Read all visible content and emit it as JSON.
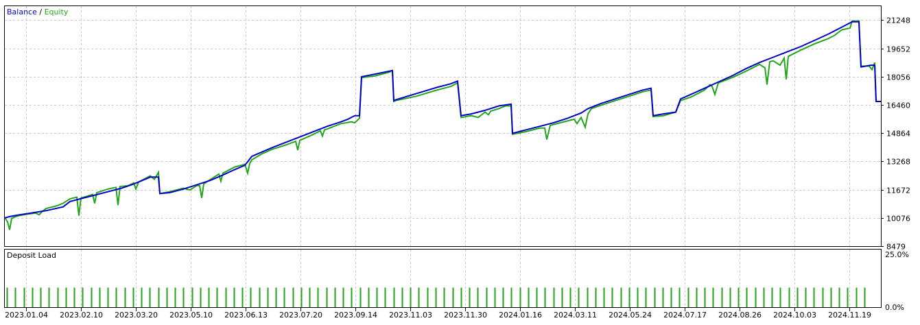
{
  "chart_data": [
    {
      "type": "line",
      "legend": [
        "Balance",
        "Equity"
      ],
      "legend_separator": "/",
      "colors": {
        "Balance": "#0000c8",
        "Equity": "#22a51a",
        "grid": "#c8c8c8",
        "frame": "#000000"
      },
      "grid": true,
      "legend_placement": "top-left",
      "ylim": [
        8479,
        22035
      ],
      "y_ticks": [
        21248,
        19652,
        18056,
        16460,
        14864,
        13268,
        11672,
        10076,
        8479
      ],
      "x_ticks": [
        "2023.01.04",
        "2023.02.10",
        "2023.03.20",
        "2023.05.10",
        "2023.06.13",
        "2023.07.20",
        "2023.09.14",
        "2023.11.03",
        "2023.11.30",
        "2024.01.16",
        "2024.03.11",
        "2024.05.24",
        "2024.07.17",
        "2024.08.26",
        "2024.10.03",
        "2024.11.19"
      ],
      "series": [
        {
          "name": "Balance",
          "x": [
            0,
            7,
            20,
            35,
            60,
            85,
            95,
            110,
            130,
            150,
            170,
            185,
            198,
            212,
            224,
            226,
            240,
            260,
            280,
            300,
            318,
            335,
            350,
            360,
            375,
            390,
            410,
            430,
            450,
            470,
            490,
            500,
            510,
            517,
            520,
            540,
            565,
            567,
            570,
            600,
            630,
            650,
            660,
            665,
            680,
            700,
            720,
            738,
            740,
            760,
            780,
            800,
            820,
            840,
            850,
            870,
            890,
            910,
            930,
            942,
            945,
            960,
            978,
            985,
            1000,
            1020,
            1040,
            1060,
            1080,
            1100,
            1120,
            1140,
            1160,
            1180,
            1200,
            1220,
            1235,
            1245,
            1248,
            1262,
            1268,
            1270,
            1278
          ],
          "y": [
            10076,
            10150,
            10240,
            10330,
            10480,
            10700,
            11000,
            11150,
            11350,
            11550,
            11750,
            11950,
            12150,
            12380,
            12380,
            11450,
            11500,
            11700,
            11950,
            12200,
            12500,
            12800,
            13050,
            13550,
            13800,
            14050,
            14350,
            14650,
            14950,
            15250,
            15500,
            15650,
            15850,
            15850,
            18050,
            18200,
            18400,
            16700,
            16750,
            17100,
            17450,
            17650,
            17800,
            15850,
            15950,
            16150,
            16400,
            16500,
            14850,
            15050,
            15250,
            15450,
            15700,
            16000,
            16250,
            16550,
            16800,
            17050,
            17300,
            17400,
            15850,
            15950,
            16050,
            16800,
            17050,
            17400,
            17750,
            18100,
            18500,
            18850,
            19150,
            19450,
            19750,
            20100,
            20450,
            20850,
            21150,
            21150,
            18600,
            18700,
            18700,
            16650,
            16650
          ]
        },
        {
          "name": "Equity",
          "x": [
            0,
            4,
            7,
            10,
            13,
            20,
            35,
            45,
            50,
            55,
            60,
            75,
            85,
            95,
            105,
            108,
            111,
            120,
            128,
            131,
            134,
            150,
            162,
            165,
            168,
            180,
            188,
            191,
            195,
            205,
            212,
            218,
            224,
            226,
            240,
            260,
            270,
            280,
            284,
            287,
            290,
            300,
            312,
            315,
            318,
            335,
            350,
            354,
            357,
            360,
            375,
            390,
            410,
            424,
            427,
            430,
            450,
            460,
            463,
            466,
            470,
            490,
            505,
            510,
            517,
            520,
            540,
            560,
            565,
            567,
            570,
            600,
            630,
            650,
            660,
            665,
            680,
            690,
            700,
            705,
            708,
            712,
            720,
            730,
            738,
            740,
            760,
            780,
            787,
            790,
            795,
            800,
            820,
            830,
            834,
            840,
            846,
            850,
            855,
            870,
            890,
            910,
            930,
            942,
            945,
            960,
            978,
            985,
            1000,
            1020,
            1028,
            1031,
            1035,
            1040,
            1060,
            1080,
            1100,
            1108,
            1111,
            1115,
            1120,
            1130,
            1136,
            1139,
            1142,
            1160,
            1180,
            1200,
            1210,
            1220,
            1232,
            1235,
            1245,
            1248,
            1260,
            1264,
            1268,
            1270,
            1278
          ],
          "y": [
            10076,
            9850,
            9400,
            10050,
            10100,
            10200,
            10300,
            10350,
            10250,
            10450,
            10600,
            10750,
            10900,
            11150,
            11250,
            10200,
            11200,
            11300,
            11400,
            10900,
            11500,
            11700,
            11800,
            10800,
            11850,
            11900,
            12050,
            11700,
            12100,
            12300,
            12450,
            12250,
            12650,
            11450,
            11550,
            11750,
            11650,
            11900,
            11900,
            11200,
            12000,
            12250,
            12550,
            12150,
            12600,
            12950,
            13100,
            12600,
            13150,
            13350,
            13700,
            13950,
            14200,
            14400,
            13900,
            14450,
            14800,
            15000,
            14700,
            15050,
            15100,
            15400,
            15500,
            15450,
            15700,
            18000,
            18100,
            18300,
            18400,
            16650,
            16700,
            16950,
            17300,
            17500,
            17700,
            15750,
            15850,
            15750,
            16050,
            15900,
            16100,
            16150,
            16250,
            16400,
            16400,
            14800,
            14950,
            15150,
            15150,
            14500,
            15300,
            15350,
            15550,
            15650,
            15400,
            15750,
            15200,
            15950,
            16250,
            16450,
            16700,
            16950,
            17200,
            17300,
            15800,
            15850,
            16050,
            16700,
            16900,
            17300,
            17600,
            17500,
            17050,
            17700,
            18000,
            18350,
            18750,
            18550,
            17600,
            18900,
            18950,
            18700,
            19100,
            17900,
            19200,
            19550,
            19900,
            20200,
            20400,
            20700,
            20800,
            21200,
            21200,
            18650,
            18650,
            18450,
            18850,
            16650,
            16650
          ]
        }
      ]
    },
    {
      "type": "bar",
      "title": "Deposit Load",
      "colors": {
        "bar": "#22a51a"
      },
      "ylim": [
        0,
        25
      ],
      "y_ticks": [
        "25.0%",
        "0.0%"
      ],
      "bar_level_percent": 8.5,
      "bar_count": 103
    }
  ]
}
